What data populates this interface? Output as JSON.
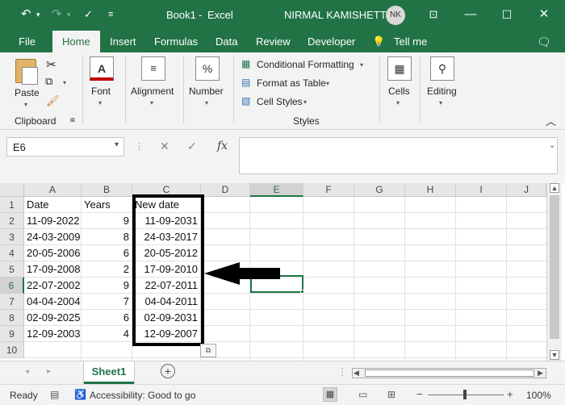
{
  "titlebar": {
    "workbook": "Book1",
    "separator": "-",
    "app": "Excel",
    "user_name": "NIRMAL KAMISHETTY",
    "user_initials": "NK"
  },
  "tabs": [
    "File",
    "Home",
    "Insert",
    "Formulas",
    "Data",
    "Review",
    "Developer",
    "Tell me"
  ],
  "ribbon": {
    "paste": "Paste",
    "clipboard": "Clipboard",
    "font": "Font",
    "font_icon": "A",
    "alignment": "Alignment",
    "number": "Number",
    "number_icon": "%",
    "conditional_formatting": "Conditional Formatting",
    "format_as_table": "Format as Table",
    "cell_styles": "Cell Styles",
    "styles": "Styles",
    "cells": "Cells",
    "editing": "Editing"
  },
  "formula_bar": {
    "name_box": "E6",
    "fx": "fx",
    "formula": ""
  },
  "grid": {
    "columns": [
      "A",
      "B",
      "C",
      "D",
      "E",
      "F",
      "G",
      "H",
      "I",
      "J"
    ],
    "selected_column": "E",
    "selected_row": "6",
    "row_numbers": [
      "1",
      "2",
      "3",
      "4",
      "5",
      "6",
      "7",
      "8",
      "9",
      "10"
    ],
    "headers": {
      "a": "Date",
      "b": "Years",
      "c": "New date"
    },
    "rows": [
      {
        "a": "11-09-2022",
        "b": "9",
        "c": "11-09-2031"
      },
      {
        "a": "24-03-2009",
        "b": "8",
        "c": "24-03-2017"
      },
      {
        "a": "20-05-2006",
        "b": "6",
        "c": "20-05-2012"
      },
      {
        "a": "17-09-2008",
        "b": "2",
        "c": "17-09-2010"
      },
      {
        "a": "22-07-2002",
        "b": "9",
        "c": "22-07-2011"
      },
      {
        "a": "04-04-2004",
        "b": "7",
        "c": "04-04-2011"
      },
      {
        "a": "02-09-2025",
        "b": "6",
        "c": "02-09-2031"
      },
      {
        "a": "12-09-2003",
        "b": "4",
        "c": "12-09-2007"
      }
    ]
  },
  "sheets": {
    "active": "Sheet1"
  },
  "status": {
    "ready": "Ready",
    "accessibility": "Accessibility: Good to go",
    "zoom": "100%"
  },
  "colors": {
    "excel_green": "#217346",
    "highlight_border": "#000000"
  }
}
